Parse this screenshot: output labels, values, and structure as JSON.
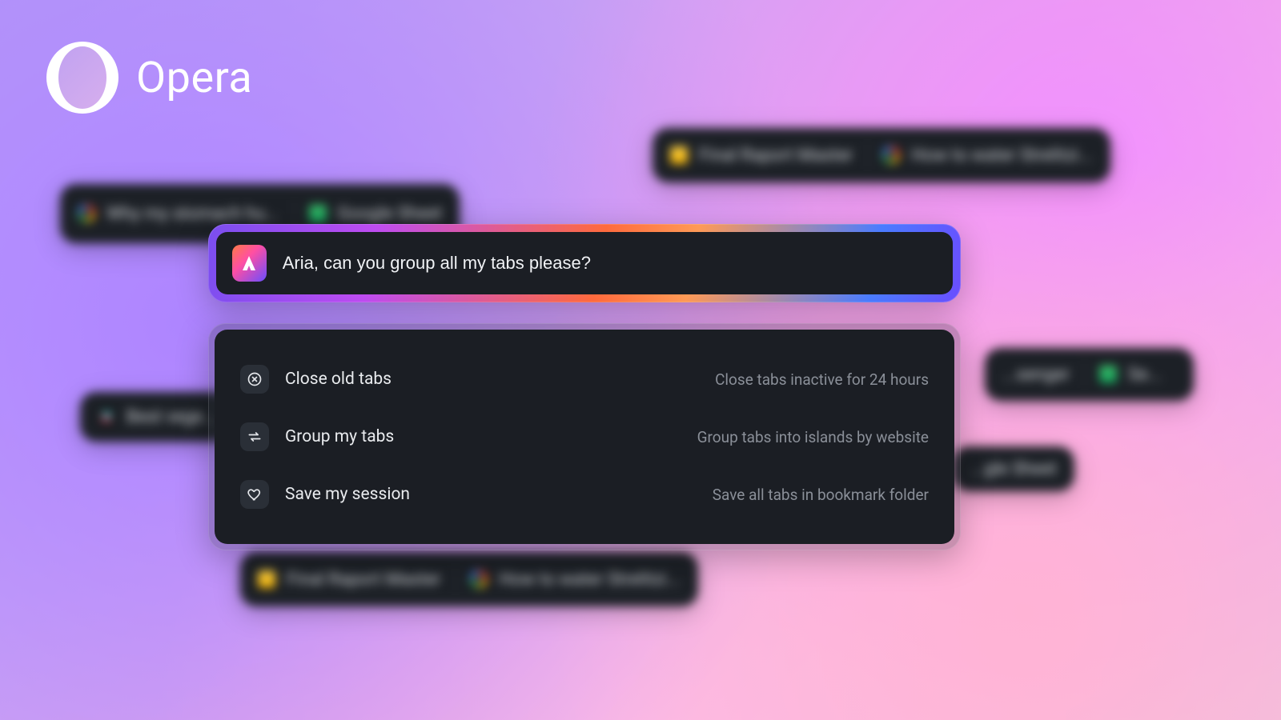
{
  "brand": {
    "name": "Opera"
  },
  "command": {
    "input_value": "Aria, can you group all my tabs please?"
  },
  "suggestions": [
    {
      "label": "Close old tabs",
      "description": "Close tabs inactive for 24 hours",
      "icon": "close"
    },
    {
      "label": "Group my tabs",
      "description": "Group tabs into islands by website",
      "icon": "swap"
    },
    {
      "label": "Save my session",
      "description": "Save all tabs in bookmark folder",
      "icon": "heart"
    }
  ],
  "background_tabs": {
    "group_top_left": [
      {
        "icon": "google",
        "title": "Why my stomach hu..."
      },
      {
        "icon": "gsheet",
        "title": "Google Sheet"
      }
    ],
    "group_top_right": [
      {
        "icon": "gdoc",
        "title": "Final Raport Master"
      },
      {
        "icon": "google",
        "title": "How to water Strelitzi..."
      }
    ],
    "group_mid_left": [
      {
        "icon": "tiktok",
        "title": "Best vege..."
      }
    ],
    "group_mid_right": [
      {
        "icon": "generic",
        "title": "...senger"
      },
      {
        "icon": "gsheet",
        "title": "Se..."
      }
    ],
    "group_low_right": [
      {
        "icon": "generic",
        "title": "...gle Sheet"
      }
    ],
    "group_bottom": [
      {
        "icon": "gdoc",
        "title": "Final Raport Master"
      },
      {
        "icon": "google",
        "title": "How to water Strelitzi..."
      }
    ]
  }
}
